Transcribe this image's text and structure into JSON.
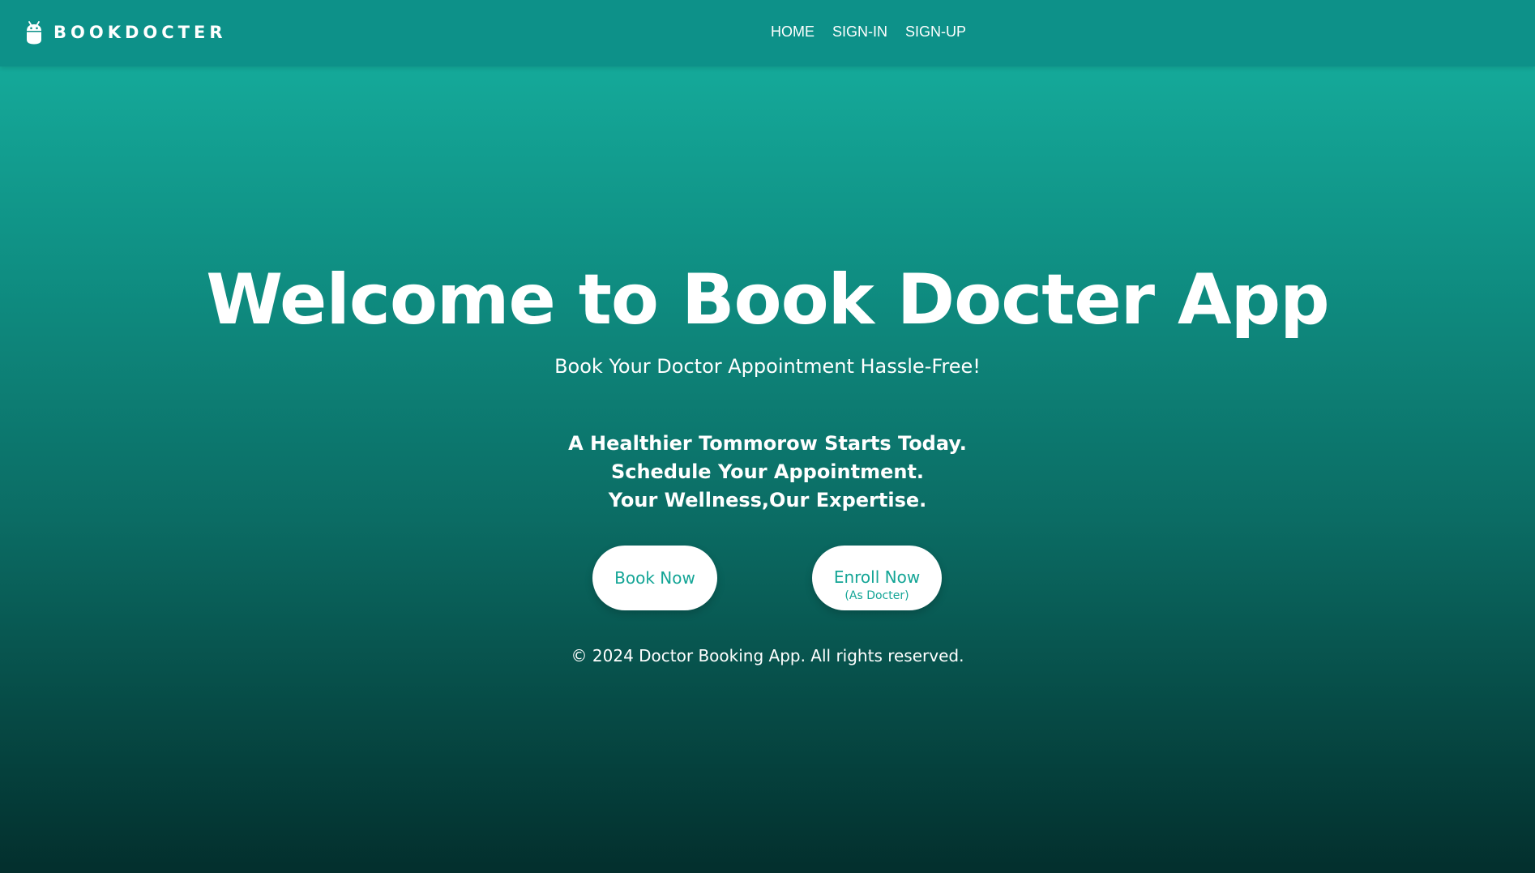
{
  "navbar": {
    "brand": {
      "icon": "android-robot-icon",
      "text": "BOOKDOCTER"
    },
    "links": [
      {
        "label": "HOME"
      },
      {
        "label": "SIGN-IN"
      },
      {
        "label": "SIGN-UP"
      }
    ],
    "background_color": "#0d9189"
  },
  "hero": {
    "title": "Welcome to Book Docter App",
    "subtitle": "Book Your Doctor Appointment Hassle-Free!",
    "taglines": [
      "A Healthier Tommorow Starts Today.",
      "Schedule Your Appointment.",
      "Your Wellness,Our Expertise."
    ],
    "buttons": {
      "book": {
        "label": "Book Now"
      },
      "enroll": {
        "label": "Enroll Now",
        "sublabel": "(As Docter)"
      }
    }
  },
  "footer": {
    "text": "© 2024 Doctor Booking App. All rights reserved."
  },
  "colors": {
    "accent": "#14a596",
    "gradient_top": "#14b3a1",
    "gradient_bottom": "#032f2d",
    "button_bg": "#ffffff",
    "text": "#ffffff"
  }
}
